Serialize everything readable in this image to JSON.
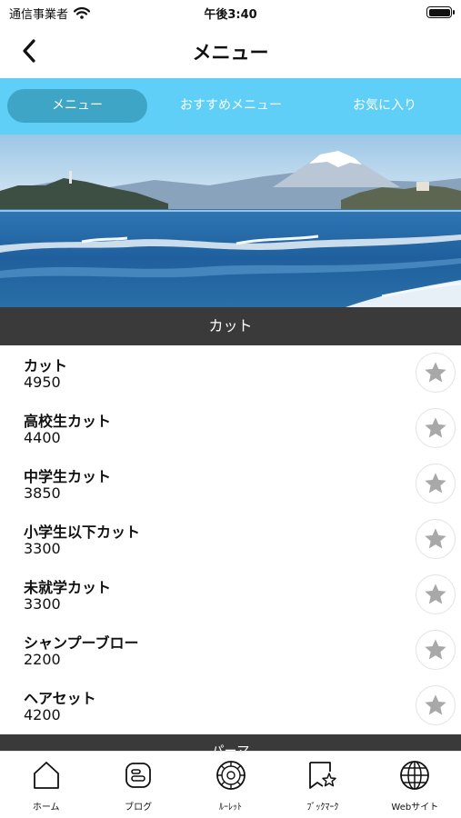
{
  "status_bar": {
    "carrier": "通信事業者",
    "time": "午後3:40",
    "icons": [
      "wifi-icon",
      "battery-icon"
    ]
  },
  "header": {
    "title": "メニュー",
    "back_icon": "chevron-left-icon"
  },
  "tabs": [
    {
      "label": "メニュー",
      "active": true
    },
    {
      "label": "おすすめメニュー",
      "active": false
    },
    {
      "label": "お気に入り",
      "active": false
    }
  ],
  "hero": {
    "description_icon": "mount-fuji-seaside-photo"
  },
  "section": {
    "title": "カット",
    "next_title": "パーマ"
  },
  "menu_items": [
    {
      "name": "カット",
      "price": "4950"
    },
    {
      "name": "高校生カット",
      "price": "4400"
    },
    {
      "name": "中学生カット",
      "price": "3850"
    },
    {
      "name": "小学生以下カット",
      "price": "3300"
    },
    {
      "name": "未就学カット",
      "price": "3300"
    },
    {
      "name": "シャンプーブロー",
      "price": "2200"
    },
    {
      "name": "ヘアセット",
      "price": "4200"
    }
  ],
  "bottom_nav": [
    {
      "label": "ホーム",
      "icon": "home-icon"
    },
    {
      "label": "ブログ",
      "icon": "blog-icon"
    },
    {
      "label": "ﾙｰﾚｯﾄ",
      "icon": "roulette-icon"
    },
    {
      "label": "ﾌﾞｯｸﾏｰｸ",
      "icon": "bookmark-icon"
    },
    {
      "label": "Webサイト",
      "icon": "globe-icon"
    }
  ],
  "colors": {
    "tab_bar": "#5fcff7",
    "tab_active": "#3ea5c6",
    "section_header": "#3a3a3a",
    "star": "#a8a8a8"
  }
}
